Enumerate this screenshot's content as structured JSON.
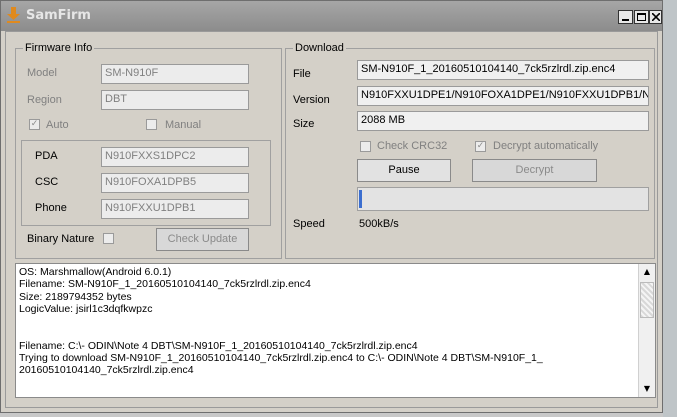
{
  "window": {
    "title": "SamFirm",
    "minimize": "_",
    "maximize": "□",
    "close": "X"
  },
  "firmware": {
    "legend": "Firmware Info",
    "model_label": "Model",
    "model_value": "SM-N910F",
    "region_label": "Region",
    "region_value": "DBT",
    "auto_label": "Auto",
    "auto_checked": true,
    "manual_label": "Manual",
    "manual_checked": false,
    "pda_label": "PDA",
    "pda_value": "N910FXXS1DPC2",
    "csc_label": "CSC",
    "csc_value": "N910FOXA1DPB5",
    "phone_label": "Phone",
    "phone_value": "N910FXXU1DPB1",
    "binary_label": "Binary Nature",
    "binary_checked": false,
    "check_update_label": "Check Update"
  },
  "download": {
    "legend": "Download",
    "file_label": "File",
    "file_value": "SM-N910F_1_20160510104140_7ck5rzlrdl.zip.enc4",
    "version_label": "Version",
    "version_value": "N910FXXU1DPE1/N910FOXA1DPE1/N910FXXU1DPB1/N",
    "size_label": "Size",
    "size_value": "2088 MB",
    "crc_label": "Check CRC32",
    "crc_checked": false,
    "decrypt_label": "Decrypt automatically",
    "decrypt_checked": true,
    "pause_label": "Pause",
    "decrypt_button_label": "Decrypt",
    "progress": 0.01,
    "speed_label": "Speed",
    "speed_value": "500kB/s"
  },
  "log": {
    "lines": [
      "OS: Marshmallow(Android 6.0.1)",
      "Filename: SM-N910F_1_20160510104140_7ck5rzlrdl.zip.enc4",
      "Size: 2189794352 bytes",
      "LogicValue: jsirl1c3dqfkwpzc",
      "",
      "",
      "Filename: C:\\- ODIN\\Note 4 DBT\\SM-N910F_1_20160510104140_7ck5rzlrdl.zip.enc4",
      "Trying to download SM-N910F_1_20160510104140_7ck5rzlrdl.zip.enc4 to C:\\- ODIN\\Note 4 DBT\\SM-N910F_1_",
      "20160510104140_7ck5rzlrdl.zip.enc4"
    ],
    "scroll_up": "▲",
    "scroll_down": "▼"
  }
}
